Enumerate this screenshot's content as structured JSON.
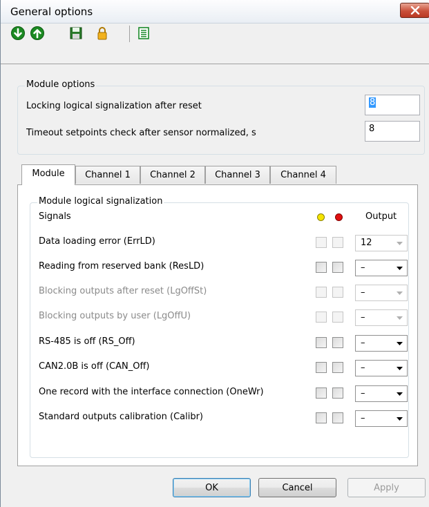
{
  "window": {
    "title": "General options"
  },
  "toolbar": {
    "icons": [
      "download-icon",
      "upload-icon",
      "save-icon",
      "lock-icon",
      "list-icon"
    ]
  },
  "module_options": {
    "legend": "Module options",
    "rows": [
      {
        "label": "Locking logical signalization after reset",
        "value": "8"
      },
      {
        "label": "Timeout setpoints check after sensor normalized, s",
        "value": "8"
      }
    ]
  },
  "tabs": [
    {
      "label": "Module",
      "active": true
    },
    {
      "label": "Channel 1",
      "active": false
    },
    {
      "label": "Channel 2",
      "active": false
    },
    {
      "label": "Channel 3",
      "active": false
    },
    {
      "label": "Channel 4",
      "active": false
    }
  ],
  "signalization": {
    "legend": "Module logical signalization",
    "header_signals": "Signals",
    "header_output": "Output",
    "colors": {
      "yellow": "#f5e400",
      "red": "#e01010"
    },
    "rows": [
      {
        "label": "Data loading error (ErrLD)",
        "output": "12",
        "enabled": false
      },
      {
        "label": "Reading from reserved bank (ResLD)",
        "output": "–",
        "enabled": true
      },
      {
        "label": "Blocking outputs after reset (LgOffSt)",
        "output": "–",
        "enabled": false
      },
      {
        "label": "Blocking outputs by user (LgOffU)",
        "output": "–",
        "enabled": false
      },
      {
        "label": "RS-485 is off (RS_Off)",
        "output": "–",
        "enabled": true
      },
      {
        "label": "CAN2.0B is off (CAN_Off)",
        "output": "–",
        "enabled": true
      },
      {
        "label": "One record with the interface connection (OneWr)",
        "output": "–",
        "enabled": true
      },
      {
        "label": "Standard outputs calibration (Calibr)",
        "output": "–",
        "enabled": true
      }
    ]
  },
  "buttons": {
    "ok": "OK",
    "cancel": "Cancel",
    "apply": "Apply"
  }
}
